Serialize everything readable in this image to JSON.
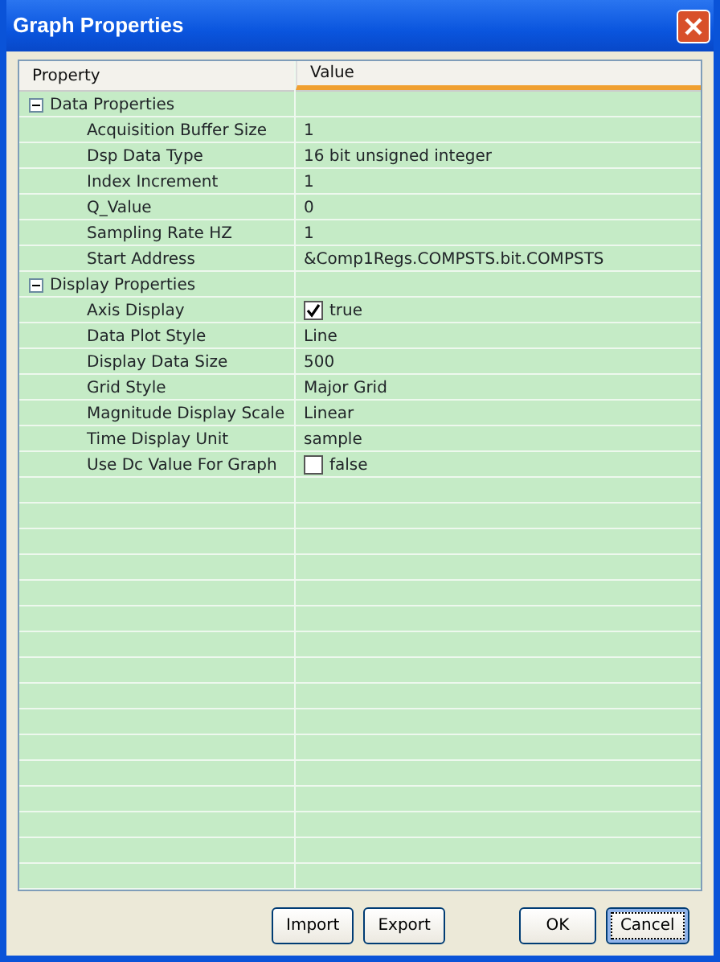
{
  "window": {
    "title": "Graph Properties"
  },
  "columns": [
    "Property",
    "Value"
  ],
  "groups": [
    {
      "label": "Data Properties",
      "expanded": true,
      "rows": [
        {
          "kind": "text",
          "name": "Acquisition Buffer Size",
          "value": "1"
        },
        {
          "kind": "text",
          "name": "Dsp Data Type",
          "value": "16 bit unsigned integer"
        },
        {
          "kind": "text",
          "name": "Index Increment",
          "value": "1"
        },
        {
          "kind": "text",
          "name": "Q_Value",
          "value": "0"
        },
        {
          "kind": "text",
          "name": "Sampling Rate HZ",
          "value": "1"
        },
        {
          "kind": "text",
          "name": "Start Address",
          "value": "&Comp1Regs.COMPSTS.bit.COMPSTS"
        }
      ]
    },
    {
      "label": "Display Properties",
      "expanded": true,
      "rows": [
        {
          "kind": "checkbox",
          "name": "Axis Display",
          "value": "true",
          "checked": true
        },
        {
          "kind": "text",
          "name": "Data Plot Style",
          "value": "Line"
        },
        {
          "kind": "text",
          "name": "Display Data Size",
          "value": "500"
        },
        {
          "kind": "text",
          "name": "Grid Style",
          "value": "Major Grid"
        },
        {
          "kind": "text",
          "name": "Magnitude Display Scale",
          "value": "Linear"
        },
        {
          "kind": "text",
          "name": "Time Display Unit",
          "value": "sample"
        },
        {
          "kind": "checkbox",
          "name": "Use Dc Value For Graph",
          "value": "false",
          "checked": false
        }
      ]
    }
  ],
  "buttons": [
    {
      "label": "Import",
      "focused": false
    },
    {
      "label": "Export",
      "focused": false
    },
    {
      "label": "OK",
      "focused": false
    },
    {
      "label": "Cancel",
      "focused": true
    }
  ]
}
